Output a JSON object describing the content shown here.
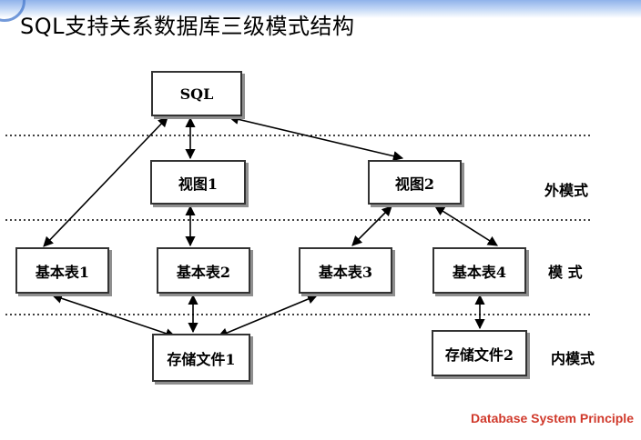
{
  "title": "SQL支持关系数据库三级模式结构",
  "footer": "Database System Principle",
  "nodes": {
    "sql": "SQL",
    "view1": "视图1",
    "view2": "视图2",
    "base1": "基本表1",
    "base2": "基本表2",
    "base3": "基本表3",
    "base4": "基本表4",
    "file1": "存储文件1",
    "file2": "存储文件2"
  },
  "levels": {
    "external": "外模式",
    "conceptual": "模 式",
    "internal": "内模式"
  },
  "edges": [
    {
      "from": "sql",
      "to": "view1"
    },
    {
      "from": "sql",
      "to": "view2"
    },
    {
      "from": "sql",
      "to": "base1"
    },
    {
      "from": "view1",
      "to": "base2"
    },
    {
      "from": "view2",
      "to": "base3"
    },
    {
      "from": "view2",
      "to": "base4"
    },
    {
      "from": "base1",
      "to": "file1"
    },
    {
      "from": "base2",
      "to": "file1"
    },
    {
      "from": "base3",
      "to": "file1"
    },
    {
      "from": "base4",
      "to": "file2"
    }
  ]
}
